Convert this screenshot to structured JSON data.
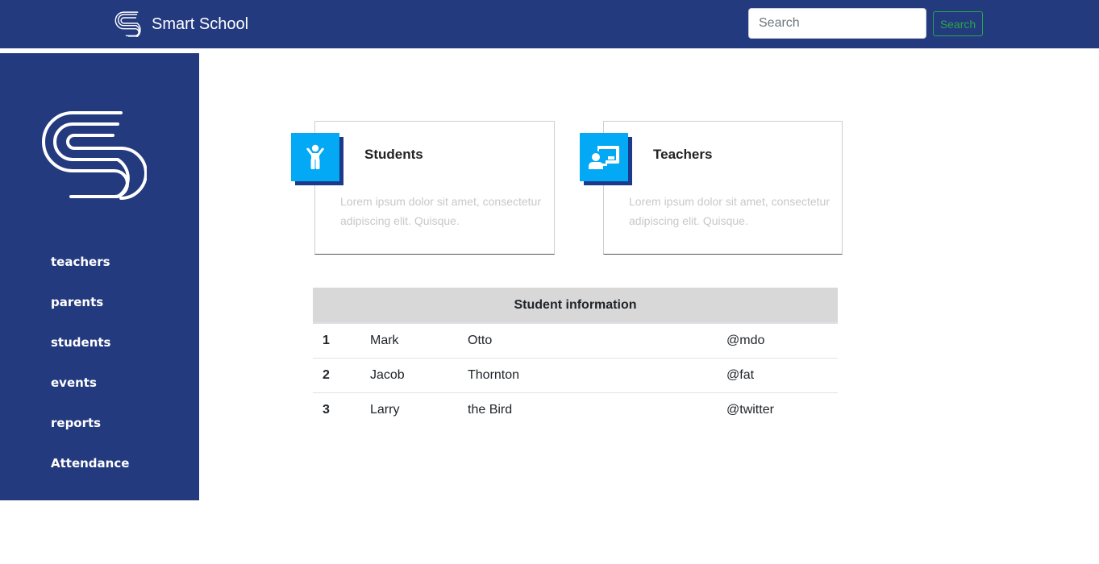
{
  "navbar": {
    "brand": "Smart School",
    "search_placeholder": "Search",
    "search_button": "Search"
  },
  "sidebar": {
    "items": [
      {
        "label": "teachers"
      },
      {
        "label": "parents"
      },
      {
        "label": "students"
      },
      {
        "label": "events"
      },
      {
        "label": "reports"
      },
      {
        "label": "Attendance"
      }
    ]
  },
  "cards": [
    {
      "title": "Students",
      "icon": "child-icon",
      "description": "Lorem ipsum dolor sit amet, consectetur adipiscing elit. Quisque."
    },
    {
      "title": "Teachers",
      "icon": "chalkboard-teacher-icon",
      "description": "Lorem ipsum dolor sit amet, consectetur adipiscing elit. Quisque."
    }
  ],
  "table": {
    "caption": "Student information",
    "rows": [
      {
        "num": "1",
        "first": "Mark",
        "last": "Otto",
        "handle": "@mdo"
      },
      {
        "num": "2",
        "first": "Jacob",
        "last": "Thornton",
        "handle": "@fat"
      },
      {
        "num": "3",
        "first": "Larry",
        "last": "the Bird",
        "handle": "@twitter"
      }
    ]
  },
  "colors": {
    "primary": "#243a7f",
    "accent": "#03a9f4",
    "success": "#28a745"
  }
}
